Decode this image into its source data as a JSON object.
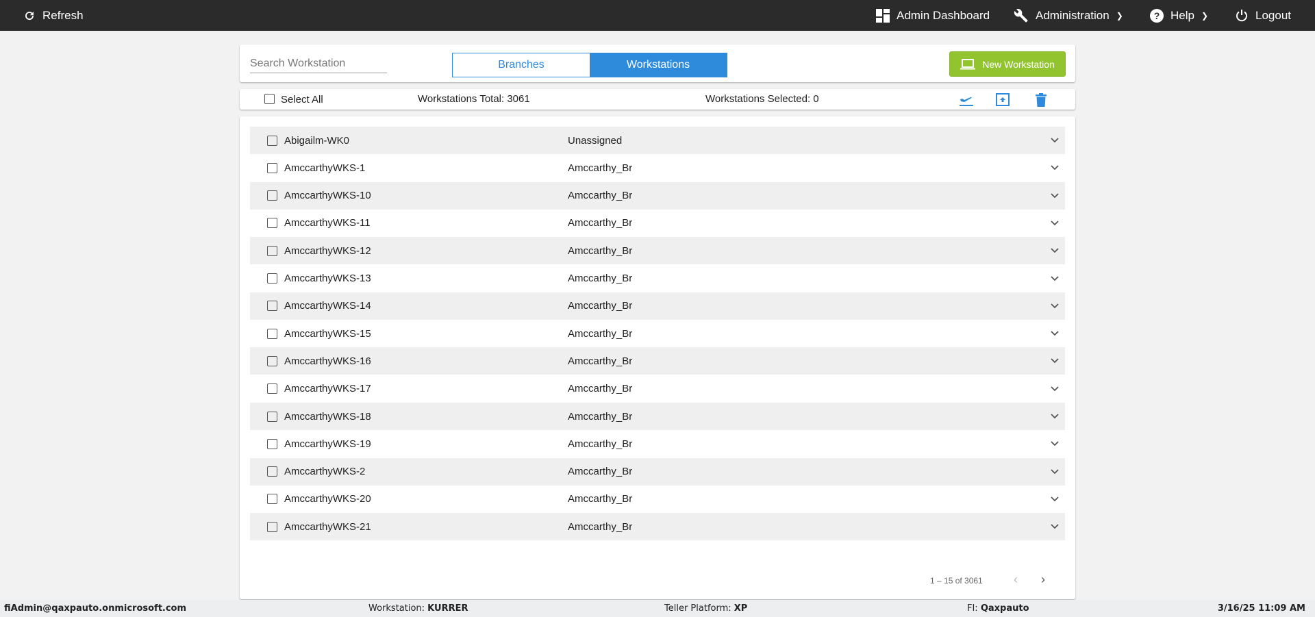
{
  "topbar": {
    "refresh": "Refresh",
    "admin_dashboard": "Admin Dashboard",
    "administration": "Administration",
    "help": "Help",
    "logout": "Logout"
  },
  "header": {
    "search_placeholder": "Search Workstation",
    "tabs": [
      {
        "label": "Branches",
        "active": false
      },
      {
        "label": "Workstations",
        "active": true
      }
    ],
    "new_button": "New Workstation"
  },
  "toolbar": {
    "select_all": "Select All",
    "total": "Workstations Total: 3061",
    "selected": "Workstations Selected: 0"
  },
  "rows": [
    {
      "name": "Abigailm-WK0",
      "branch": "Unassigned"
    },
    {
      "name": "AmccarthyWKS-1",
      "branch": "Amccarthy_Br"
    },
    {
      "name": "AmccarthyWKS-10",
      "branch": "Amccarthy_Br"
    },
    {
      "name": "AmccarthyWKS-11",
      "branch": "Amccarthy_Br"
    },
    {
      "name": "AmccarthyWKS-12",
      "branch": "Amccarthy_Br"
    },
    {
      "name": "AmccarthyWKS-13",
      "branch": "Amccarthy_Br"
    },
    {
      "name": "AmccarthyWKS-14",
      "branch": "Amccarthy_Br"
    },
    {
      "name": "AmccarthyWKS-15",
      "branch": "Amccarthy_Br"
    },
    {
      "name": "AmccarthyWKS-16",
      "branch": "Amccarthy_Br"
    },
    {
      "name": "AmccarthyWKS-17",
      "branch": "Amccarthy_Br"
    },
    {
      "name": "AmccarthyWKS-18",
      "branch": "Amccarthy_Br"
    },
    {
      "name": "AmccarthyWKS-19",
      "branch": "Amccarthy_Br"
    },
    {
      "name": "AmccarthyWKS-2",
      "branch": "Amccarthy_Br"
    },
    {
      "name": "AmccarthyWKS-20",
      "branch": "Amccarthy_Br"
    },
    {
      "name": "AmccarthyWKS-21",
      "branch": "Amccarthy_Br"
    }
  ],
  "pagination": {
    "range": "1 – 15 of 3061"
  },
  "footer": {
    "user": "fiAdmin@qaxpauto.onmicrosoft.com",
    "workstation_label": "Workstation: ",
    "workstation": "KURRER",
    "platform_label": "Teller Platform: ",
    "platform": "XP",
    "fi_label": "FI: ",
    "fi": "Qaxpauto",
    "datetime": "3/16/25 11:09 AM"
  },
  "colors": {
    "accent": "#2e8bdc",
    "new_button": "#92c42f",
    "topbar": "#2b2b2b"
  }
}
